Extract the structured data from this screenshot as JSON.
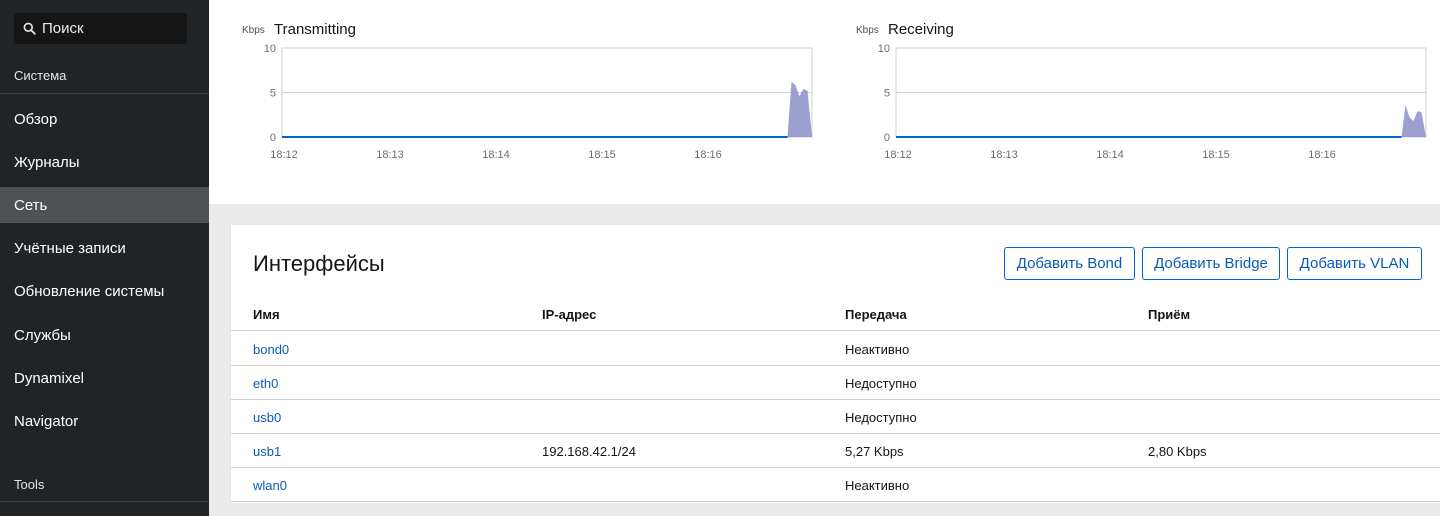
{
  "sidebar": {
    "search_placeholder": "Поиск",
    "group_system": "Система",
    "items": [
      {
        "label": "Обзор"
      },
      {
        "label": "Журналы"
      },
      {
        "label": "Сеть"
      },
      {
        "label": "Учётные записи"
      },
      {
        "label": "Обновление системы"
      },
      {
        "label": "Службы"
      },
      {
        "label": "Dynamixel"
      },
      {
        "label": "Navigator"
      }
    ],
    "group_tools": "Tools",
    "active_item": "Сеть"
  },
  "charts": {
    "transmitting": {
      "unit": "Kbps",
      "title": "Transmitting"
    },
    "receiving": {
      "unit": "Kbps",
      "title": "Receiving"
    }
  },
  "chart_data": [
    {
      "type": "area",
      "title": "Transmitting",
      "ylabel": "Kbps",
      "ylim": [
        0,
        10
      ],
      "y_ticks": [
        "0",
        "5",
        "10"
      ],
      "x_ticks": [
        "18:12",
        "18:13",
        "18:14",
        "18:15",
        "18:16"
      ],
      "x_minutes": [
        0,
        0.95,
        0.97,
        1.0,
        1.02,
        1.05,
        1.08
      ],
      "series": [
        {
          "values": [
            0,
            0,
            6.2,
            5.8,
            4.6,
            5.4,
            5.2
          ],
          "spike_start_minute": 4.75
        }
      ],
      "grid": true
    },
    {
      "type": "area",
      "title": "Receiving",
      "ylabel": "Kbps",
      "ylim": [
        0,
        10
      ],
      "y_ticks": [
        "0",
        "5",
        "10"
      ],
      "x_ticks": [
        "18:12",
        "18:13",
        "18:14",
        "18:15",
        "18:16"
      ],
      "series": [
        {
          "values": [
            0,
            0,
            3.6,
            2.2,
            1.8,
            2.9,
            2.8
          ],
          "spike_start_minute": 4.75
        }
      ],
      "grid": true
    }
  ],
  "interfaces": {
    "title": "Интерфейсы",
    "buttons": {
      "add_bond": "Добавить Bond",
      "add_bridge": "Добавить Bridge",
      "add_vlan": "Добавить VLAN"
    },
    "columns": {
      "name": "Имя",
      "ip": "IP-адрес",
      "tx": "Передача",
      "rx": "Приём"
    },
    "rows": [
      {
        "name": "bond0",
        "ip": "",
        "tx": "Неактивно",
        "rx": ""
      },
      {
        "name": "eth0",
        "ip": "",
        "tx": "Недоступно",
        "rx": ""
      },
      {
        "name": "usb0",
        "ip": "",
        "tx": "Недоступно",
        "rx": ""
      },
      {
        "name": "usb1",
        "ip": "192.168.42.1/24",
        "tx": "5,27 Kbps",
        "rx": "2,80 Kbps"
      },
      {
        "name": "wlan0",
        "ip": "",
        "tx": "Неактивно",
        "rx": ""
      }
    ]
  },
  "colors": {
    "accent": "#0066cc",
    "sidebar_bg": "#212427",
    "sidebar_active": "#4f5255",
    "chart_line": "#06c",
    "chart_fill": "#8b8fc8"
  }
}
